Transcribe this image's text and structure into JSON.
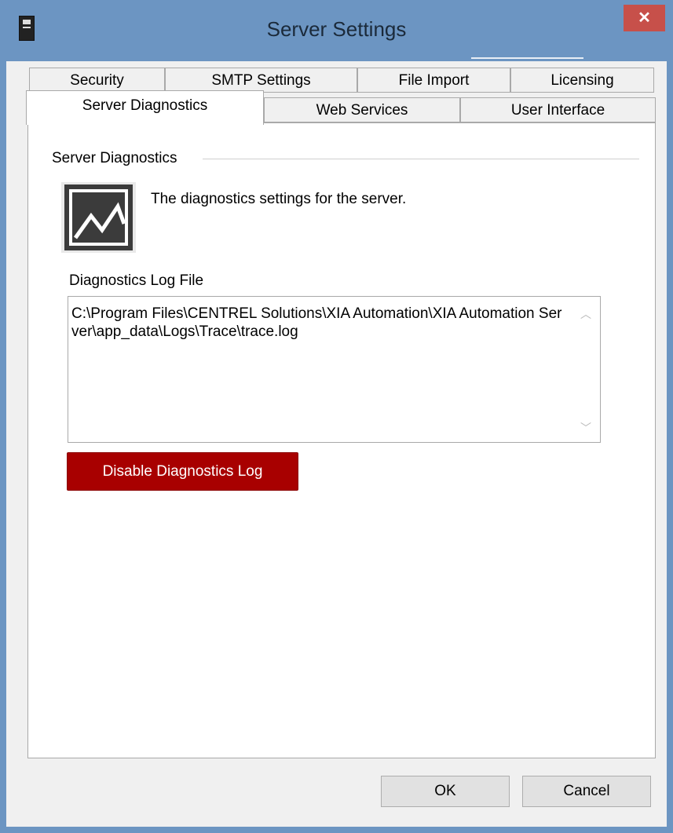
{
  "window": {
    "title": "Server Settings",
    "close_glyph": "✕"
  },
  "tabs": {
    "row1": [
      "Security",
      "SMTP Settings",
      "File Import",
      "Licensing"
    ],
    "row2": [
      "Server Diagnostics",
      "Web Services",
      "User Interface"
    ],
    "active": "Server Diagnostics"
  },
  "panel": {
    "group_title": "Server Diagnostics",
    "icon": "chart-line-icon",
    "description": "The diagnostics settings for the server.",
    "log_file_label": "Diagnostics Log File",
    "log_file_value": "C:\\Program Files\\CENTREL Solutions\\XIA Automation\\XIA Automation Server\\app_data\\Logs\\Trace\\trace.log",
    "scroll_up_glyph": "︿",
    "scroll_down_glyph": "﹀",
    "disable_button": "Disable Diagnostics Log"
  },
  "footer": {
    "ok": "OK",
    "cancel": "Cancel"
  },
  "colors": {
    "titlebar": "#6c95c2",
    "close_button": "#c7504a",
    "disable_button": "#a80000"
  }
}
